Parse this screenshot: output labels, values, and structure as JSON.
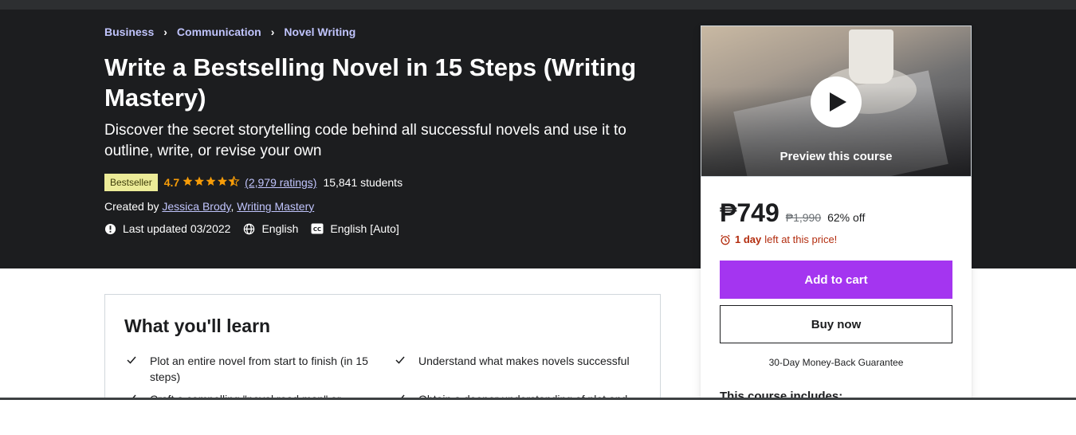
{
  "breadcrumb": {
    "items": [
      "Business",
      "Communication",
      "Novel Writing"
    ],
    "separator": "›"
  },
  "course": {
    "title": "Write a Bestselling Novel in 15 Steps (Writing Mastery)",
    "subtitle": "Discover the secret storytelling code behind all successful novels and use it to outline, write, or revise your own",
    "badge": "Bestseller",
    "rating": "4.7",
    "stars": 4.7,
    "ratings_count": "(2,979 ratings)",
    "students": "15,841 students",
    "created_by_label": "Created by",
    "instructors": [
      "Jessica Brody",
      "Writing Mastery"
    ],
    "instructor_separator": ",",
    "last_updated": "Last updated 03/2022",
    "language": "English",
    "captions": "English [Auto]"
  },
  "sidebar": {
    "preview_label": "Preview this course",
    "price": "₱749",
    "original_price": "₱1,990",
    "discount": "62% off",
    "timer_bold": "1 day",
    "timer_rest": "left at this price!",
    "add_to_cart": "Add to cart",
    "buy_now": "Buy now",
    "guarantee": "30-Day Money-Back Guarantee",
    "includes_title": "This course includes:"
  },
  "learn": {
    "title": "What you'll learn",
    "items": [
      "Plot an entire novel from start to finish (in 15 steps)",
      "Understand what makes novels successful",
      "Craft a compelling \"novel road map\" or",
      "Obtain a deeper understanding of plot and"
    ]
  },
  "colors": {
    "hero_bg": "#1c1d1f",
    "link_purple": "#c0c4fc",
    "star_orange": "#f69c08",
    "cta_purple": "#a435f0",
    "timer_red": "#b32d0f",
    "badge_yellow": "#eceb98"
  },
  "icons": {
    "last_updated": "alert-badge-icon",
    "language": "globe-icon",
    "captions": "closed-captions-icon",
    "timer": "alarm-clock-icon",
    "learn_bullet": "check-icon",
    "preview": "play-icon"
  }
}
